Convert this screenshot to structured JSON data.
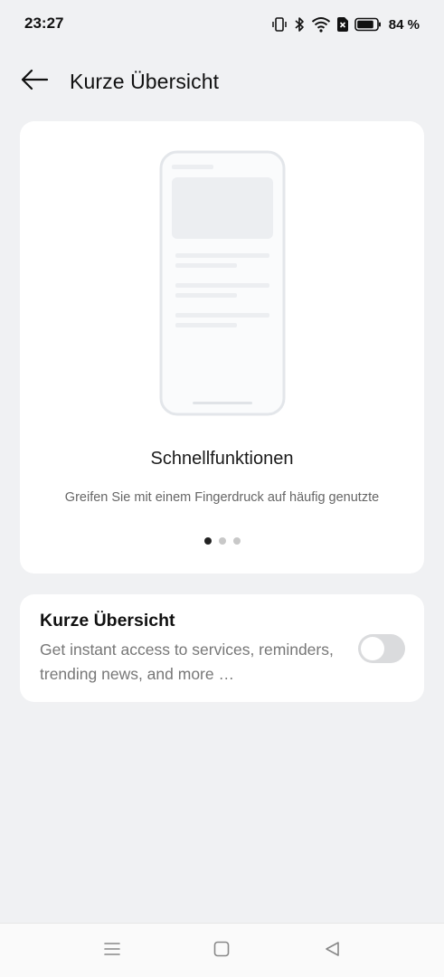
{
  "status_bar": {
    "time": "23:27",
    "battery_percent": "84 %",
    "icons": [
      "vibrate-icon",
      "bluetooth-icon",
      "wifi-icon",
      "no-sim-icon",
      "battery-icon"
    ]
  },
  "header": {
    "back_icon": "arrow-left-icon",
    "title": "Kurze Übersicht"
  },
  "carousel": {
    "illustration": "phone-mockup-icon",
    "slide_title": "Schnellfunktionen",
    "slide_description": "Greifen Sie mit einem Fingerdruck auf häufig genutzte",
    "pages": 3,
    "active_page": 1
  },
  "feature": {
    "title": "Kurze Übersicht",
    "description": "Get instant access to services, reminders, trending news, and more …",
    "enabled": false
  },
  "nav_bar": {
    "buttons": [
      "menu-icon",
      "home-icon",
      "back-triangle-icon"
    ]
  },
  "colors": {
    "background": "#f0f1f3",
    "card": "#ffffff",
    "switch_off": "#dadbdd",
    "dot_active": "#222222",
    "dot_inactive": "#c8c8c8"
  }
}
